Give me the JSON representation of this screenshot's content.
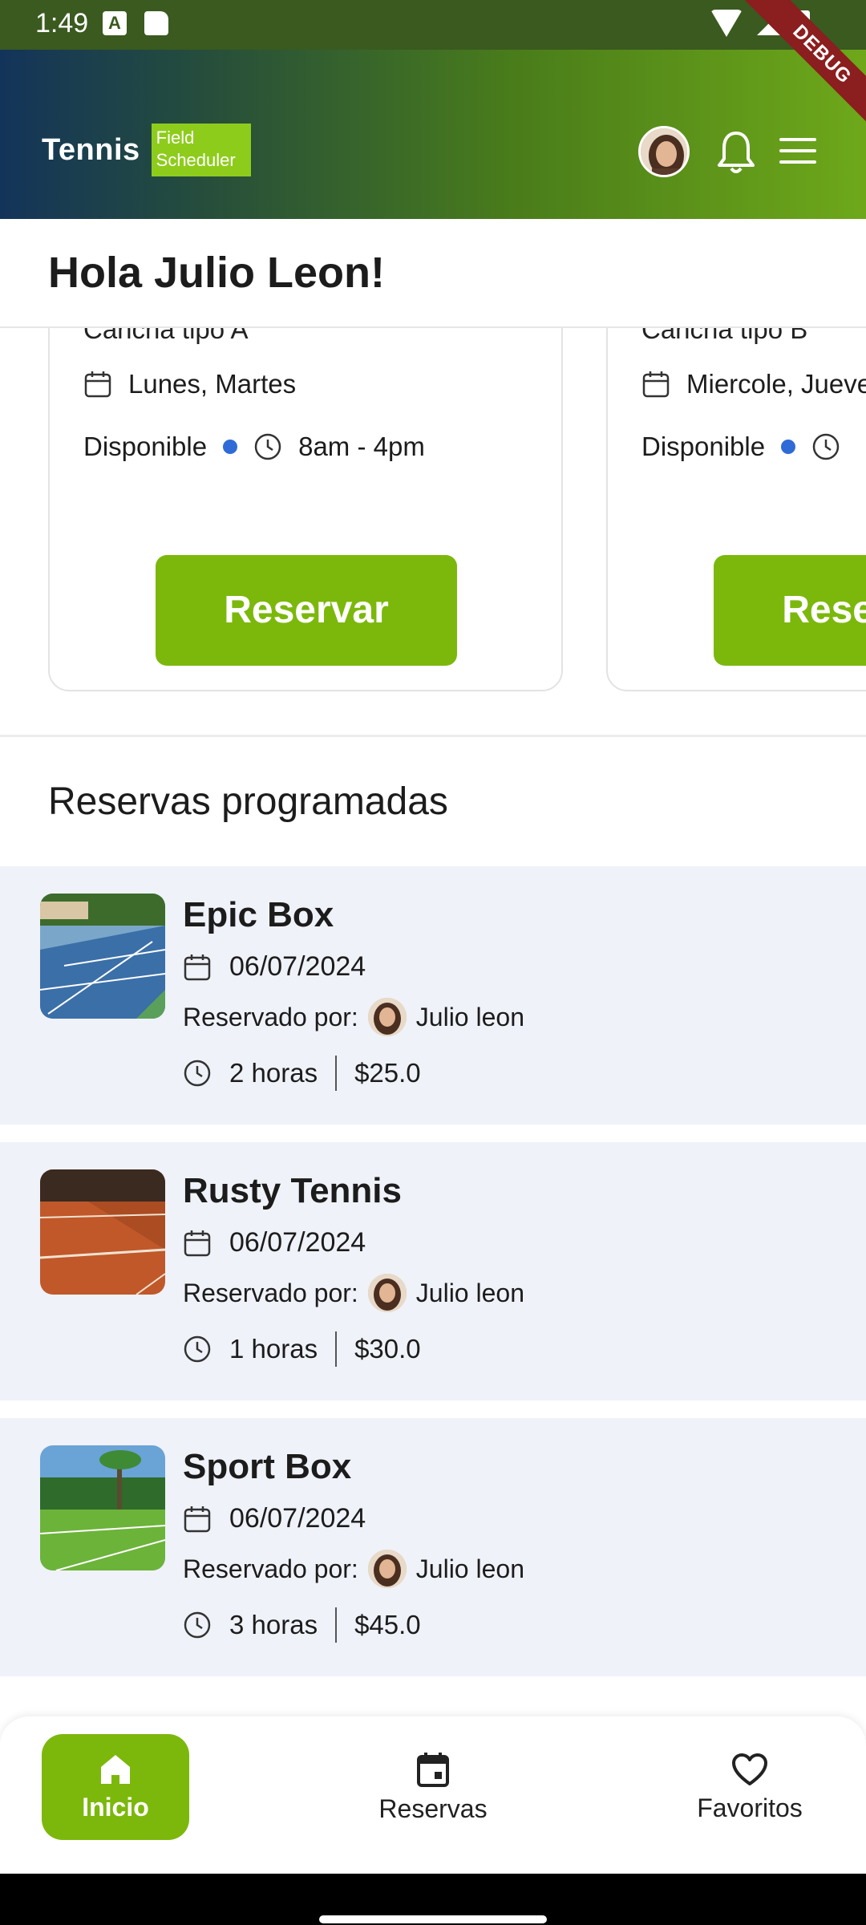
{
  "status_bar": {
    "time": "1:49"
  },
  "header": {
    "brand": "Tennis",
    "brand_sub": "Field Scheduler",
    "debug_label": "DEBUG"
  },
  "greeting": "Hola Julio Leon!",
  "fields": [
    {
      "type": "Cancha tipo A",
      "days": "Lunes, Martes",
      "availability": "Disponible",
      "hours": "8am - 4pm",
      "button": "Reservar"
    },
    {
      "type": "Cancha tipo B",
      "days": "Miercole, Jueves",
      "availability": "Disponible",
      "hours": "",
      "button": "Reservar"
    }
  ],
  "section_title": "Reservas programadas",
  "reservations": [
    {
      "name": "Epic Box",
      "date": "06/07/2024",
      "reserved_by_label": "Reservado por:",
      "reserved_by": "Julio leon",
      "duration": "2 horas",
      "price": "$25.0"
    },
    {
      "name": "Rusty Tennis",
      "date": "06/07/2024",
      "reserved_by_label": "Reservado por:",
      "reserved_by": "Julio leon",
      "duration": "1 horas",
      "price": "$30.0"
    },
    {
      "name": "Sport Box",
      "date": "06/07/2024",
      "reserved_by_label": "Reservado por:",
      "reserved_by": "Julio leon",
      "duration": "3 horas",
      "price": "$45.0"
    }
  ],
  "nav": {
    "home": "Inicio",
    "reservations": "Reservas",
    "favorites": "Favoritos"
  },
  "colors": {
    "accent": "#7cb80c",
    "status_dot": "#2f6bd6",
    "list_bg": "#eff2f8"
  }
}
